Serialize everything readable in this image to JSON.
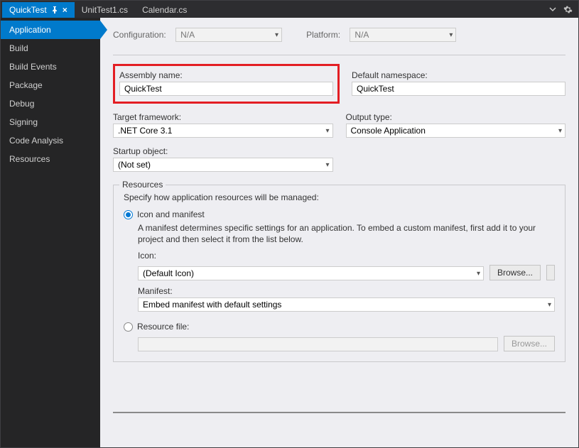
{
  "tabs": [
    {
      "label": "QuickTest",
      "active": true,
      "pinned": true
    },
    {
      "label": "UnitTest1.cs",
      "active": false
    },
    {
      "label": "Calendar.cs",
      "active": false
    }
  ],
  "sidebar": {
    "items": [
      {
        "label": "Application",
        "active": true
      },
      {
        "label": "Build"
      },
      {
        "label": "Build Events"
      },
      {
        "label": "Package"
      },
      {
        "label": "Debug"
      },
      {
        "label": "Signing"
      },
      {
        "label": "Code Analysis"
      },
      {
        "label": "Resources"
      }
    ]
  },
  "top": {
    "configuration_label": "Configuration:",
    "configuration_value": "N/A",
    "platform_label": "Platform:",
    "platform_value": "N/A"
  },
  "fields": {
    "assembly_name_label": "Assembly name:",
    "assembly_name_value": "QuickTest",
    "default_namespace_label": "Default namespace:",
    "default_namespace_value": "QuickTest",
    "target_framework_label": "Target framework:",
    "target_framework_value": ".NET Core 3.1",
    "output_type_label": "Output type:",
    "output_type_value": "Console Application",
    "startup_object_label": "Startup object:",
    "startup_object_value": "(Not set)"
  },
  "resources": {
    "group_title": "Resources",
    "description": "Specify how application resources will be managed:",
    "option_icon_label": "Icon and manifest",
    "option_icon_help": "A manifest determines specific settings for an application. To embed a custom manifest, first add it to your project and then select it from the list below.",
    "icon_label": "Icon:",
    "icon_value": "(Default Icon)",
    "browse_label": "Browse...",
    "manifest_label": "Manifest:",
    "manifest_value": "Embed manifest with default settings",
    "option_resourcefile_label": "Resource file:",
    "resourcefile_value": ""
  }
}
